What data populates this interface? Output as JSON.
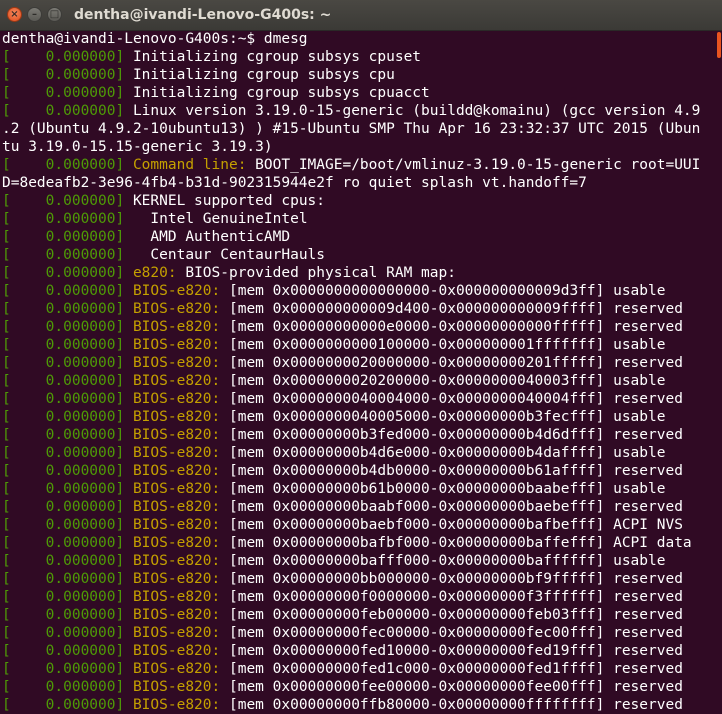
{
  "window": {
    "title": "dentha@ivandi-Lenovo-G400s: ~",
    "controls": {
      "close": "close-icon",
      "minimize": "minimize-icon",
      "maximize": "maximize-icon"
    }
  },
  "colors": {
    "background": "#300a24",
    "text": "#ffffff",
    "timestamp": "#4e9a06",
    "facility": "#c4a000",
    "accent": "#e95420"
  },
  "terminal": {
    "prompt": "dentha@ivandi-Lenovo-G400s:~$ dmesg",
    "lines": [
      {
        "ts": "[    0.000000]",
        "fac": "",
        "text": " Initializing cgroup subsys cpuset"
      },
      {
        "ts": "[    0.000000]",
        "fac": "",
        "text": " Initializing cgroup subsys cpu"
      },
      {
        "ts": "[    0.000000]",
        "fac": "",
        "text": " Initializing cgroup subsys cpuacct"
      },
      {
        "ts": "[    0.000000]",
        "fac": "",
        "text": " Linux version 3.19.0-15-generic (buildd@komainu) (gcc version 4.9"
      },
      {
        "ts": "",
        "fac": "",
        "text": ".2 (Ubuntu 4.9.2-10ubuntu13) ) #15-Ubuntu SMP Thu Apr 16 23:32:37 UTC 2015 (Ubun"
      },
      {
        "ts": "",
        "fac": "",
        "text": "tu 3.19.0-15.15-generic 3.19.3)"
      },
      {
        "ts": "[    0.000000]",
        "fac": " Command line:",
        "text": " BOOT_IMAGE=/boot/vmlinuz-3.19.0-15-generic root=UUI"
      },
      {
        "ts": "",
        "fac": "",
        "text": "D=8edeafb2-3e96-4fb4-b31d-902315944e2f ro quiet splash vt.handoff=7"
      },
      {
        "ts": "[    0.000000]",
        "fac": "",
        "text": " KERNEL supported cpus:"
      },
      {
        "ts": "[    0.000000]",
        "fac": "",
        "text": "   Intel GenuineIntel"
      },
      {
        "ts": "[    0.000000]",
        "fac": "",
        "text": "   AMD AuthenticAMD"
      },
      {
        "ts": "[    0.000000]",
        "fac": "",
        "text": "   Centaur CentaurHauls"
      },
      {
        "ts": "[    0.000000]",
        "fac": " e820:",
        "text": " BIOS-provided physical RAM map:"
      },
      {
        "ts": "[    0.000000]",
        "fac": " BIOS-e820:",
        "text": " [mem 0x0000000000000000-0x000000000009d3ff] usable"
      },
      {
        "ts": "[    0.000000]",
        "fac": " BIOS-e820:",
        "text": " [mem 0x000000000009d400-0x000000000009ffff] reserved"
      },
      {
        "ts": "[    0.000000]",
        "fac": " BIOS-e820:",
        "text": " [mem 0x00000000000e0000-0x00000000000fffff] reserved"
      },
      {
        "ts": "[    0.000000]",
        "fac": " BIOS-e820:",
        "text": " [mem 0x0000000000100000-0x000000001fffffff] usable"
      },
      {
        "ts": "[    0.000000]",
        "fac": " BIOS-e820:",
        "text": " [mem 0x0000000020000000-0x00000000201fffff] reserved"
      },
      {
        "ts": "[    0.000000]",
        "fac": " BIOS-e820:",
        "text": " [mem 0x0000000020200000-0x0000000040003fff] usable"
      },
      {
        "ts": "[    0.000000]",
        "fac": " BIOS-e820:",
        "text": " [mem 0x0000000040004000-0x0000000040004fff] reserved"
      },
      {
        "ts": "[    0.000000]",
        "fac": " BIOS-e820:",
        "text": " [mem 0x0000000040005000-0x00000000b3fecfff] usable"
      },
      {
        "ts": "[    0.000000]",
        "fac": " BIOS-e820:",
        "text": " [mem 0x00000000b3fed000-0x00000000b4d6dfff] reserved"
      },
      {
        "ts": "[    0.000000]",
        "fac": " BIOS-e820:",
        "text": " [mem 0x00000000b4d6e000-0x00000000b4daffff] usable"
      },
      {
        "ts": "[    0.000000]",
        "fac": " BIOS-e820:",
        "text": " [mem 0x00000000b4db0000-0x00000000b61affff] reserved"
      },
      {
        "ts": "[    0.000000]",
        "fac": " BIOS-e820:",
        "text": " [mem 0x00000000b61b0000-0x00000000baabefff] usable"
      },
      {
        "ts": "[    0.000000]",
        "fac": " BIOS-e820:",
        "text": " [mem 0x00000000baabf000-0x00000000baebefff] reserved"
      },
      {
        "ts": "[    0.000000]",
        "fac": " BIOS-e820:",
        "text": " [mem 0x00000000baebf000-0x00000000bafbefff] ACPI NVS"
      },
      {
        "ts": "[    0.000000]",
        "fac": " BIOS-e820:",
        "text": " [mem 0x00000000bafbf000-0x00000000baffefff] ACPI data"
      },
      {
        "ts": "[    0.000000]",
        "fac": " BIOS-e820:",
        "text": " [mem 0x00000000bafff000-0x00000000baffffff] usable"
      },
      {
        "ts": "[    0.000000]",
        "fac": " BIOS-e820:",
        "text": " [mem 0x00000000bb000000-0x00000000bf9fffff] reserved"
      },
      {
        "ts": "[    0.000000]",
        "fac": " BIOS-e820:",
        "text": " [mem 0x00000000f0000000-0x00000000f3ffffff] reserved"
      },
      {
        "ts": "[    0.000000]",
        "fac": " BIOS-e820:",
        "text": " [mem 0x00000000feb00000-0x00000000feb03fff] reserved"
      },
      {
        "ts": "[    0.000000]",
        "fac": " BIOS-e820:",
        "text": " [mem 0x00000000fec00000-0x00000000fec00fff] reserved"
      },
      {
        "ts": "[    0.000000]",
        "fac": " BIOS-e820:",
        "text": " [mem 0x00000000fed10000-0x00000000fed19fff] reserved"
      },
      {
        "ts": "[    0.000000]",
        "fac": " BIOS-e820:",
        "text": " [mem 0x00000000fed1c000-0x00000000fed1ffff] reserved"
      },
      {
        "ts": "[    0.000000]",
        "fac": " BIOS-e820:",
        "text": " [mem 0x00000000fee00000-0x00000000fee00fff] reserved"
      },
      {
        "ts": "[    0.000000]",
        "fac": " BIOS-e820:",
        "text": " [mem 0x00000000ffb80000-0x00000000ffffffff] reserved"
      }
    ]
  }
}
